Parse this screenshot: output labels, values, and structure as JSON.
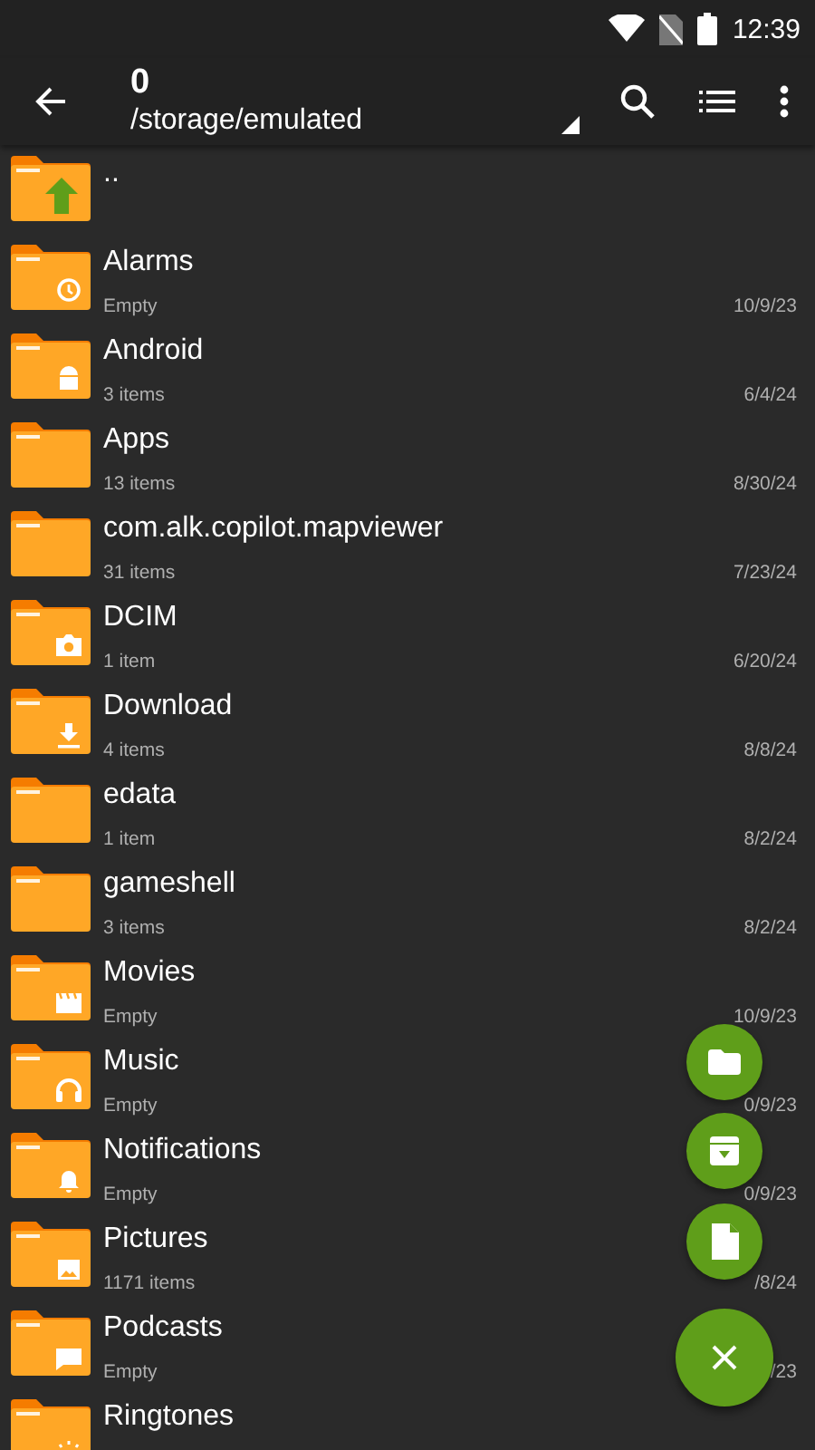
{
  "status_bar": {
    "time": "12:39"
  },
  "app_bar": {
    "title": "0",
    "path": "/storage/emulated"
  },
  "files": [
    {
      "kind": "parent",
      "name": ".."
    },
    {
      "kind": "folder",
      "name": "Alarms",
      "info": "Empty",
      "date": "10/9/23"
    },
    {
      "kind": "folder",
      "name": "Android",
      "info": "3 items",
      "date": "6/4/24"
    },
    {
      "kind": "folder",
      "name": "Apps",
      "info": "13 items",
      "date": "8/30/24"
    },
    {
      "kind": "folder",
      "name": "com.alk.copilot.mapviewer",
      "info": "31 items",
      "date": "7/23/24"
    },
    {
      "kind": "folder",
      "name": "DCIM",
      "info": "1 item",
      "date": "6/20/24"
    },
    {
      "kind": "folder",
      "name": "Download",
      "info": "4 items",
      "date": "8/8/24"
    },
    {
      "kind": "folder",
      "name": "edata",
      "info": "1 item",
      "date": "8/2/24"
    },
    {
      "kind": "folder",
      "name": "gameshell",
      "info": "3 items",
      "date": "8/2/24"
    },
    {
      "kind": "folder",
      "name": "Movies",
      "info": "Empty",
      "date": "10/9/23"
    },
    {
      "kind": "folder",
      "name": "Music",
      "info": "Empty",
      "date": "0/9/23"
    },
    {
      "kind": "folder",
      "name": "Notifications",
      "info": "Empty",
      "date": "0/9/23"
    },
    {
      "kind": "folder",
      "name": "Pictures",
      "info": "1171 items",
      "date": "/8/24"
    },
    {
      "kind": "folder",
      "name": "Podcasts",
      "info": "Empty",
      "date": "/23"
    },
    {
      "kind": "folder",
      "name": "Ringtones"
    }
  ],
  "fab_menu": {
    "expanded": true
  }
}
